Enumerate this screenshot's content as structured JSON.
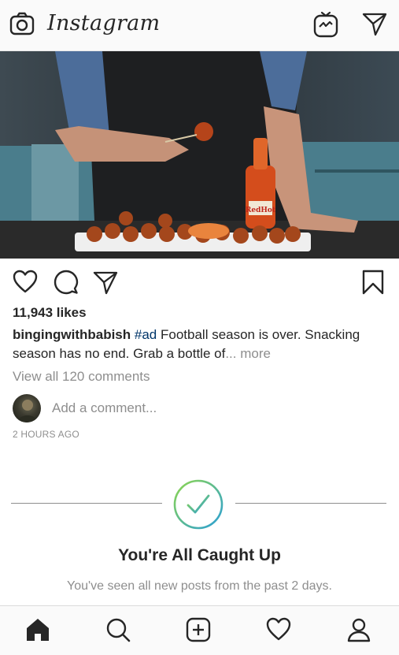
{
  "header": {
    "logo_text": "Instagram",
    "camera_icon": "camera-icon",
    "igtv_icon": "igtv-icon",
    "direct_icon": "paper-plane-icon"
  },
  "post": {
    "image_description_icon": "food-photo",
    "bottle_label": "Frank's RedHot",
    "likes": "11,943 likes",
    "username": "bingingwithbabish",
    "hashtag": "#ad",
    "caption": " Football season is over. Snacking season has no end. Grab a bottle of",
    "more": "... more",
    "view_comments": "View all 120 comments",
    "add_comment_placeholder": "Add a comment...",
    "timestamp": "2 HOURS AGO"
  },
  "caught_up": {
    "title": "You're All Caught Up",
    "subtitle": "You've seen all new posts from the past 2 days.",
    "gradient_start": "#8ed64e",
    "gradient_end": "#2a9fd6"
  },
  "nav": {
    "items": [
      "home-icon",
      "search-icon",
      "new-post-icon",
      "activity-heart-icon",
      "profile-icon"
    ]
  }
}
